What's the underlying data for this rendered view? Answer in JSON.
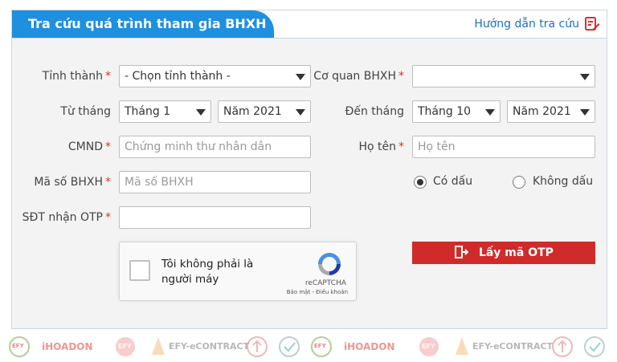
{
  "header": {
    "title": "Tra cứu quá trình tham gia BHXH",
    "help_link": "Hướng dẫn tra cứu"
  },
  "form": {
    "province": {
      "label": "Tỉnh thành",
      "value": "- Chọn tỉnh thành -"
    },
    "agency": {
      "label": "Cơ quan BHXH",
      "value": ""
    },
    "from": {
      "label": "Từ tháng",
      "month": "Tháng 1",
      "year": "Năm 2021"
    },
    "to": {
      "label": "Đến tháng",
      "month": "Tháng 10",
      "year": "Năm 2021"
    },
    "id_card": {
      "label": "CMND",
      "placeholder": "Chứng minh thư nhân dân"
    },
    "full_name": {
      "label": "Họ tên",
      "placeholder": "Họ tên"
    },
    "social_insurance_no": {
      "label": "Mã số BHXH",
      "placeholder": "Mã số BHXH"
    },
    "accent_options": {
      "with_accent": "Có dấu",
      "without_accent": "Không dấu",
      "selected": "Có dấu"
    },
    "phone_otp": {
      "label": "SĐT nhận OTP",
      "value": ""
    },
    "required_mark": "*"
  },
  "captcha": {
    "text": "Tôi không phải là người máy",
    "brand": "reCAPTCHA",
    "links": "Bảo mật - Điều khoản"
  },
  "otp_button": {
    "label": "Lấy mã OTP"
  },
  "footer_logos": [
    "EFY",
    "iHOADON",
    "EFY",
    "EFY-eCONTRACT",
    "EFY",
    "iHOADON",
    "EFY",
    "EFY-eCONTRACT"
  ],
  "colors": {
    "header_blue": "#1f8fe0",
    "link_blue": "#1b6fc9",
    "required_red": "#d9302c",
    "button_red": "#d12a2a"
  }
}
